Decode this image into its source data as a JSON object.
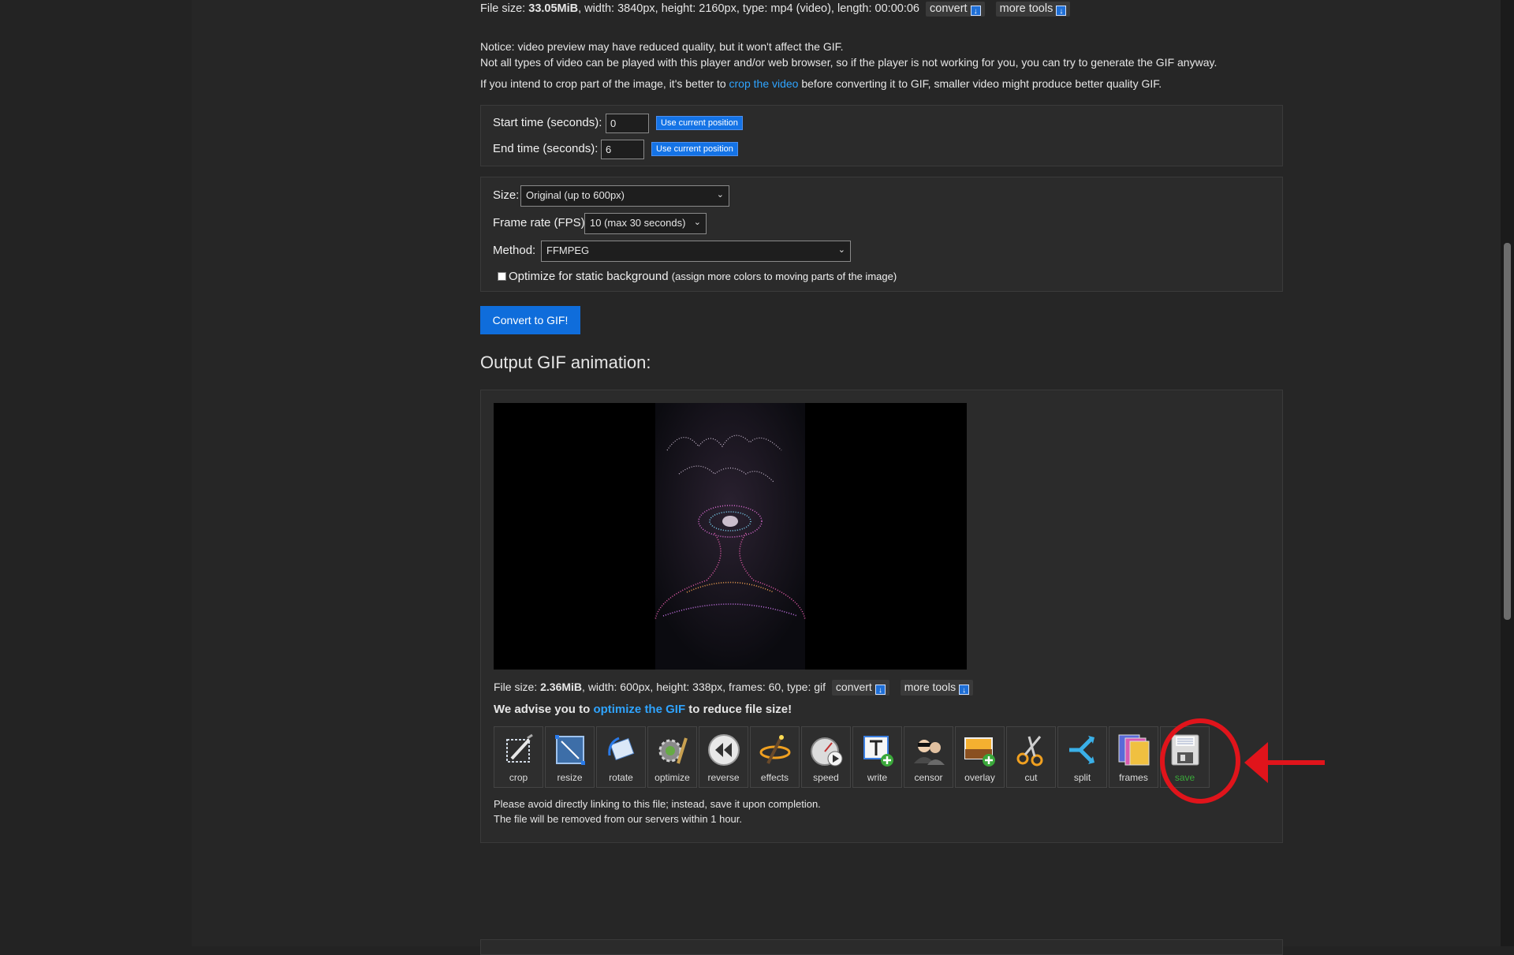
{
  "top_info": {
    "prefix": "File size: ",
    "size": "33.05MiB",
    "rest": ", width: 3840px, height: 2160px, type: mp4 (video), length: 00:00:06",
    "convert_label": "convert",
    "more_tools_label": "more tools"
  },
  "notice": {
    "line1": "Notice: video preview may have reduced quality, but it won't affect the GIF.",
    "line2": "Not all types of video can be played with this player and/or web browser, so if the player is not working for you, you can try to generate the GIF anyway.",
    "line3_before": "If you intend to crop part of the image, it's better to ",
    "line3_link": "crop the video",
    "line3_after": " before converting it to GIF, smaller video might produce better quality GIF."
  },
  "timing": {
    "start_label": "Start time (seconds):",
    "start_value": "0",
    "end_label": "End time (seconds):",
    "end_value": "6",
    "use_current_label": "Use current position"
  },
  "options": {
    "size_label": "Size:",
    "size_value": "Original (up to 600px)",
    "fps_label": "Frame rate (FPS):",
    "fps_value": "10 (max 30 seconds)",
    "method_label": "Method:",
    "method_value": "FFMPEG",
    "optimize_label": "Optimize for static background",
    "optimize_note": "(assign more colors to moving parts of the image)",
    "optimize_checked": false
  },
  "convert_button": "Convert to GIF!",
  "output": {
    "heading": "Output GIF animation:",
    "info_prefix": "File size: ",
    "info_size": "2.36MiB",
    "info_rest": ", width: 600px, height: 338px, frames: 60, type: gif",
    "convert_label": "convert",
    "more_tools_label": "more tools",
    "advise_before": "We advise you to ",
    "advise_link": "optimize the GIF",
    "advise_after": " to reduce file size!",
    "note1": "Please avoid directly linking to this file; instead, save it upon completion.",
    "note2": "The file will be removed from our servers within 1 hour."
  },
  "tools": [
    {
      "label": "crop",
      "icon": "crop-icon"
    },
    {
      "label": "resize",
      "icon": "resize-icon"
    },
    {
      "label": "rotate",
      "icon": "rotate-icon"
    },
    {
      "label": "optimize",
      "icon": "optimize-icon"
    },
    {
      "label": "reverse",
      "icon": "reverse-icon"
    },
    {
      "label": "effects",
      "icon": "effects-icon"
    },
    {
      "label": "speed",
      "icon": "speed-icon"
    },
    {
      "label": "write",
      "icon": "write-icon"
    },
    {
      "label": "censor",
      "icon": "censor-icon"
    },
    {
      "label": "overlay",
      "icon": "overlay-icon"
    },
    {
      "label": "cut",
      "icon": "cut-icon"
    },
    {
      "label": "split",
      "icon": "split-icon"
    },
    {
      "label": "frames",
      "icon": "frames-icon"
    },
    {
      "label": "save",
      "icon": "save-icon"
    }
  ],
  "colors": {
    "accent": "#1473e6",
    "link": "#2fa4ff",
    "annotation": "#e0141b"
  }
}
